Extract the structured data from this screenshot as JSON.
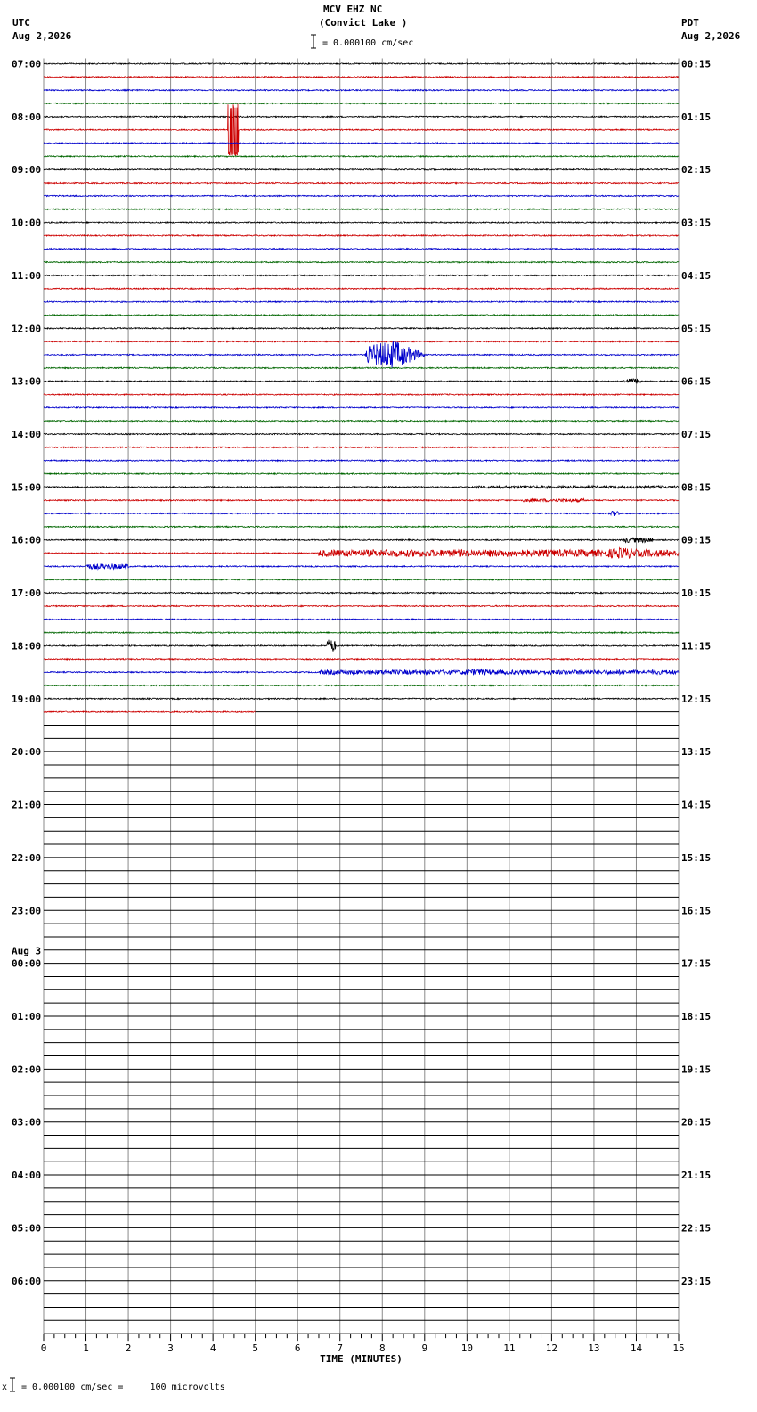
{
  "header": {
    "station": "MCV EHZ NC",
    "location": "(Convict Lake )",
    "left_zone": "UTC",
    "left_date": "Aug 2,2026",
    "right_zone": "PDT",
    "right_date": "Aug 2,2026",
    "scale": "= 0.000100 cm/sec"
  },
  "footer": {
    "scale_note": "= 0.000100 cm/sec =     100 microvolts",
    "scale_mark": "x"
  },
  "chart_data": {
    "type": "line",
    "title": "MCV EHZ NC (Convict Lake )",
    "xlabel": "TIME (MINUTES)",
    "xlim": [
      0,
      15
    ],
    "x_ticks": [
      "0",
      "1",
      "2",
      "3",
      "4",
      "5",
      "6",
      "7",
      "8",
      "9",
      "10",
      "11",
      "12",
      "13",
      "14",
      "15"
    ],
    "rows_total": 96,
    "rows_per_hour": 4,
    "minutes_per_row": 15,
    "grid": true,
    "utc_labels": [
      "07:00",
      "08:00",
      "09:00",
      "10:00",
      "11:00",
      "12:00",
      "13:00",
      "14:00",
      "15:00",
      "16:00",
      "17:00",
      "18:00",
      "19:00",
      "20:00",
      "21:00",
      "22:00",
      "23:00",
      "00:00",
      "01:00",
      "02:00",
      "03:00",
      "04:00",
      "05:00",
      "06:00"
    ],
    "utc_day_break": {
      "hour_index": 17,
      "label": "Aug 3"
    },
    "pdt_labels": [
      "00:15",
      "01:15",
      "02:15",
      "03:15",
      "04:15",
      "05:15",
      "06:15",
      "07:15",
      "08:15",
      "09:15",
      "10:15",
      "11:15",
      "12:15",
      "13:15",
      "14:15",
      "15:15",
      "16:15",
      "17:15",
      "18:15",
      "19:15",
      "20:15",
      "21:15",
      "22:15",
      "23:15"
    ],
    "trace_colors": [
      "#000000",
      "#cc0000",
      "#0000cc",
      "#006600"
    ],
    "rows_recorded": 50,
    "last_row_end_minute": 5.0,
    "events": [
      {
        "row": 5,
        "start_min": 4.35,
        "end_min": 4.6,
        "amplitude": 60,
        "type": "spike"
      },
      {
        "row": 22,
        "start_min": 7.6,
        "end_min": 9.0,
        "amplitude": 18,
        "type": "quake"
      },
      {
        "row": 24,
        "start_min": 13.7,
        "end_min": 14.1,
        "amplitude": 3,
        "type": "burst"
      },
      {
        "row": 32,
        "start_min": 10.2,
        "end_min": 15.0,
        "amplitude": 1.5,
        "type": "noise"
      },
      {
        "row": 33,
        "start_min": 11.3,
        "end_min": 12.8,
        "amplitude": 1.8,
        "type": "noise"
      },
      {
        "row": 34,
        "start_min": 13.4,
        "end_min": 13.6,
        "amplitude": 3,
        "type": "burst"
      },
      {
        "row": 36,
        "start_min": 13.7,
        "end_min": 14.4,
        "amplitude": 3,
        "type": "burst"
      },
      {
        "row": 37,
        "start_min": 6.5,
        "end_min": 15.0,
        "amplitude": 4,
        "type": "noise"
      },
      {
        "row": 37,
        "start_min": 13.1,
        "end_min": 14.5,
        "amplitude": 7,
        "type": "quake"
      },
      {
        "row": 38,
        "start_min": 1.0,
        "end_min": 2.0,
        "amplitude": 3,
        "type": "noise"
      },
      {
        "row": 44,
        "start_min": 6.7,
        "end_min": 6.9,
        "amplitude": 7,
        "type": "spike"
      },
      {
        "row": 46,
        "start_min": 6.5,
        "end_min": 15.0,
        "amplitude": 2.5,
        "type": "noise"
      },
      {
        "row": 46,
        "start_min": 9.6,
        "end_min": 11.2,
        "amplitude": 4,
        "type": "quake"
      }
    ]
  }
}
